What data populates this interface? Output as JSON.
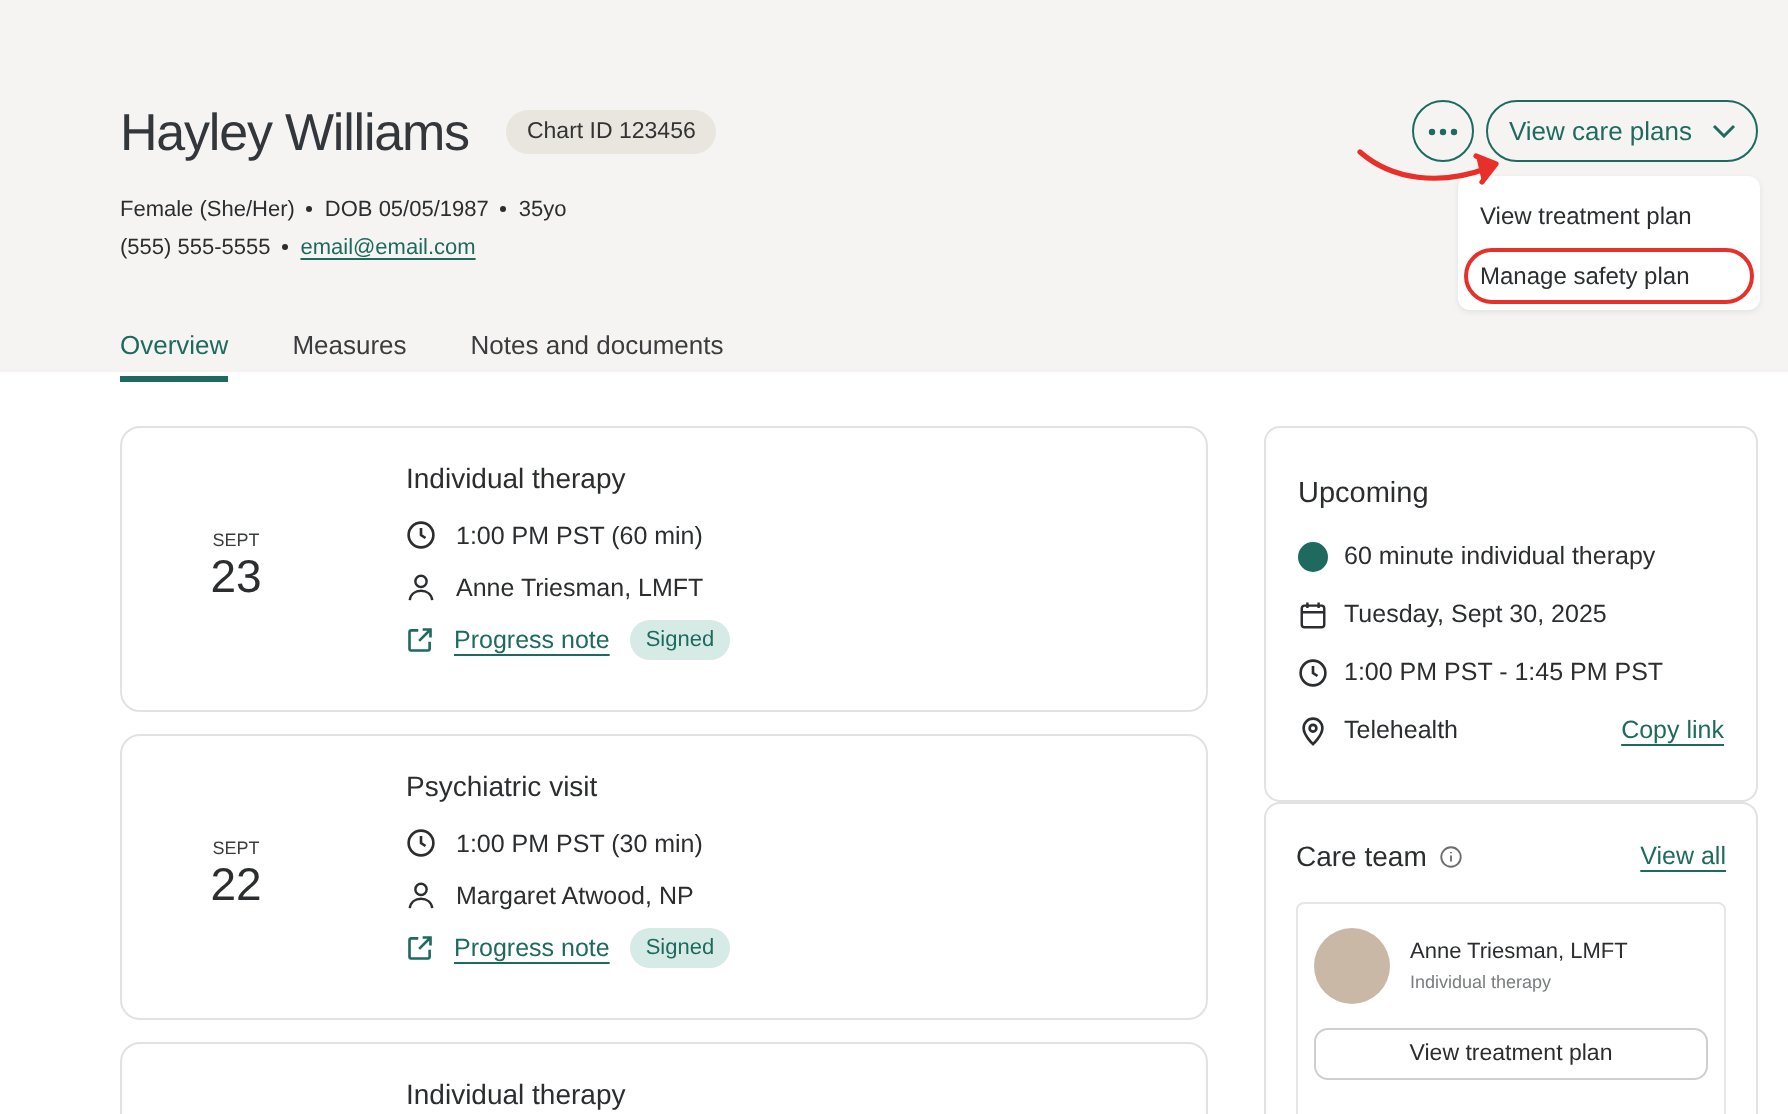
{
  "patient": {
    "name": "Hayley Williams",
    "chart_id": "Chart ID 123456",
    "demographics": [
      "Female (She/Her)",
      "DOB 05/05/1987",
      "35yo"
    ],
    "phone": "(555) 555-5555",
    "email": "email@email.com"
  },
  "tabs": [
    {
      "label": "Overview",
      "selected": true
    },
    {
      "label": "Measures",
      "selected": false
    },
    {
      "label": "Notes and documents",
      "selected": false
    }
  ],
  "care_plans_button": {
    "label": "View care plans",
    "expanded": true
  },
  "care_plans_menu": [
    {
      "label": "View treatment plan",
      "circled": false
    },
    {
      "label": "Manage safety plan",
      "circled": true
    }
  ],
  "appointments": [
    {
      "month": "SEPT",
      "day": "23",
      "title": "Individual therapy",
      "time": "1:00 PM PST (60 min)",
      "provider": "Anne Triesman, LMFT",
      "link": "Progress note",
      "status": "Signed"
    },
    {
      "month": "SEPT",
      "day": "22",
      "title": "Psychiatric visit",
      "time": "1:00 PM PST (30 min)",
      "provider": "Margaret Atwood, NP",
      "link": "Progress note",
      "status": "Signed"
    },
    {
      "title": "Individual therapy"
    }
  ],
  "upcoming": {
    "title": "Upcoming",
    "session": {
      "label": "60 minute individual therapy",
      "color": "#1e6a5f"
    },
    "date": "Tuesday, Sept 30, 2025",
    "time": "1:00 PM PST - 1:45 PM PST",
    "location": "Telehealth",
    "link": "Copy link"
  },
  "care_team": {
    "title": "Care team",
    "link": "View all",
    "members": [
      {
        "name": "Anne Triesman, LMFT",
        "role": "Individual therapy",
        "button": "View treatment plan"
      }
    ]
  }
}
